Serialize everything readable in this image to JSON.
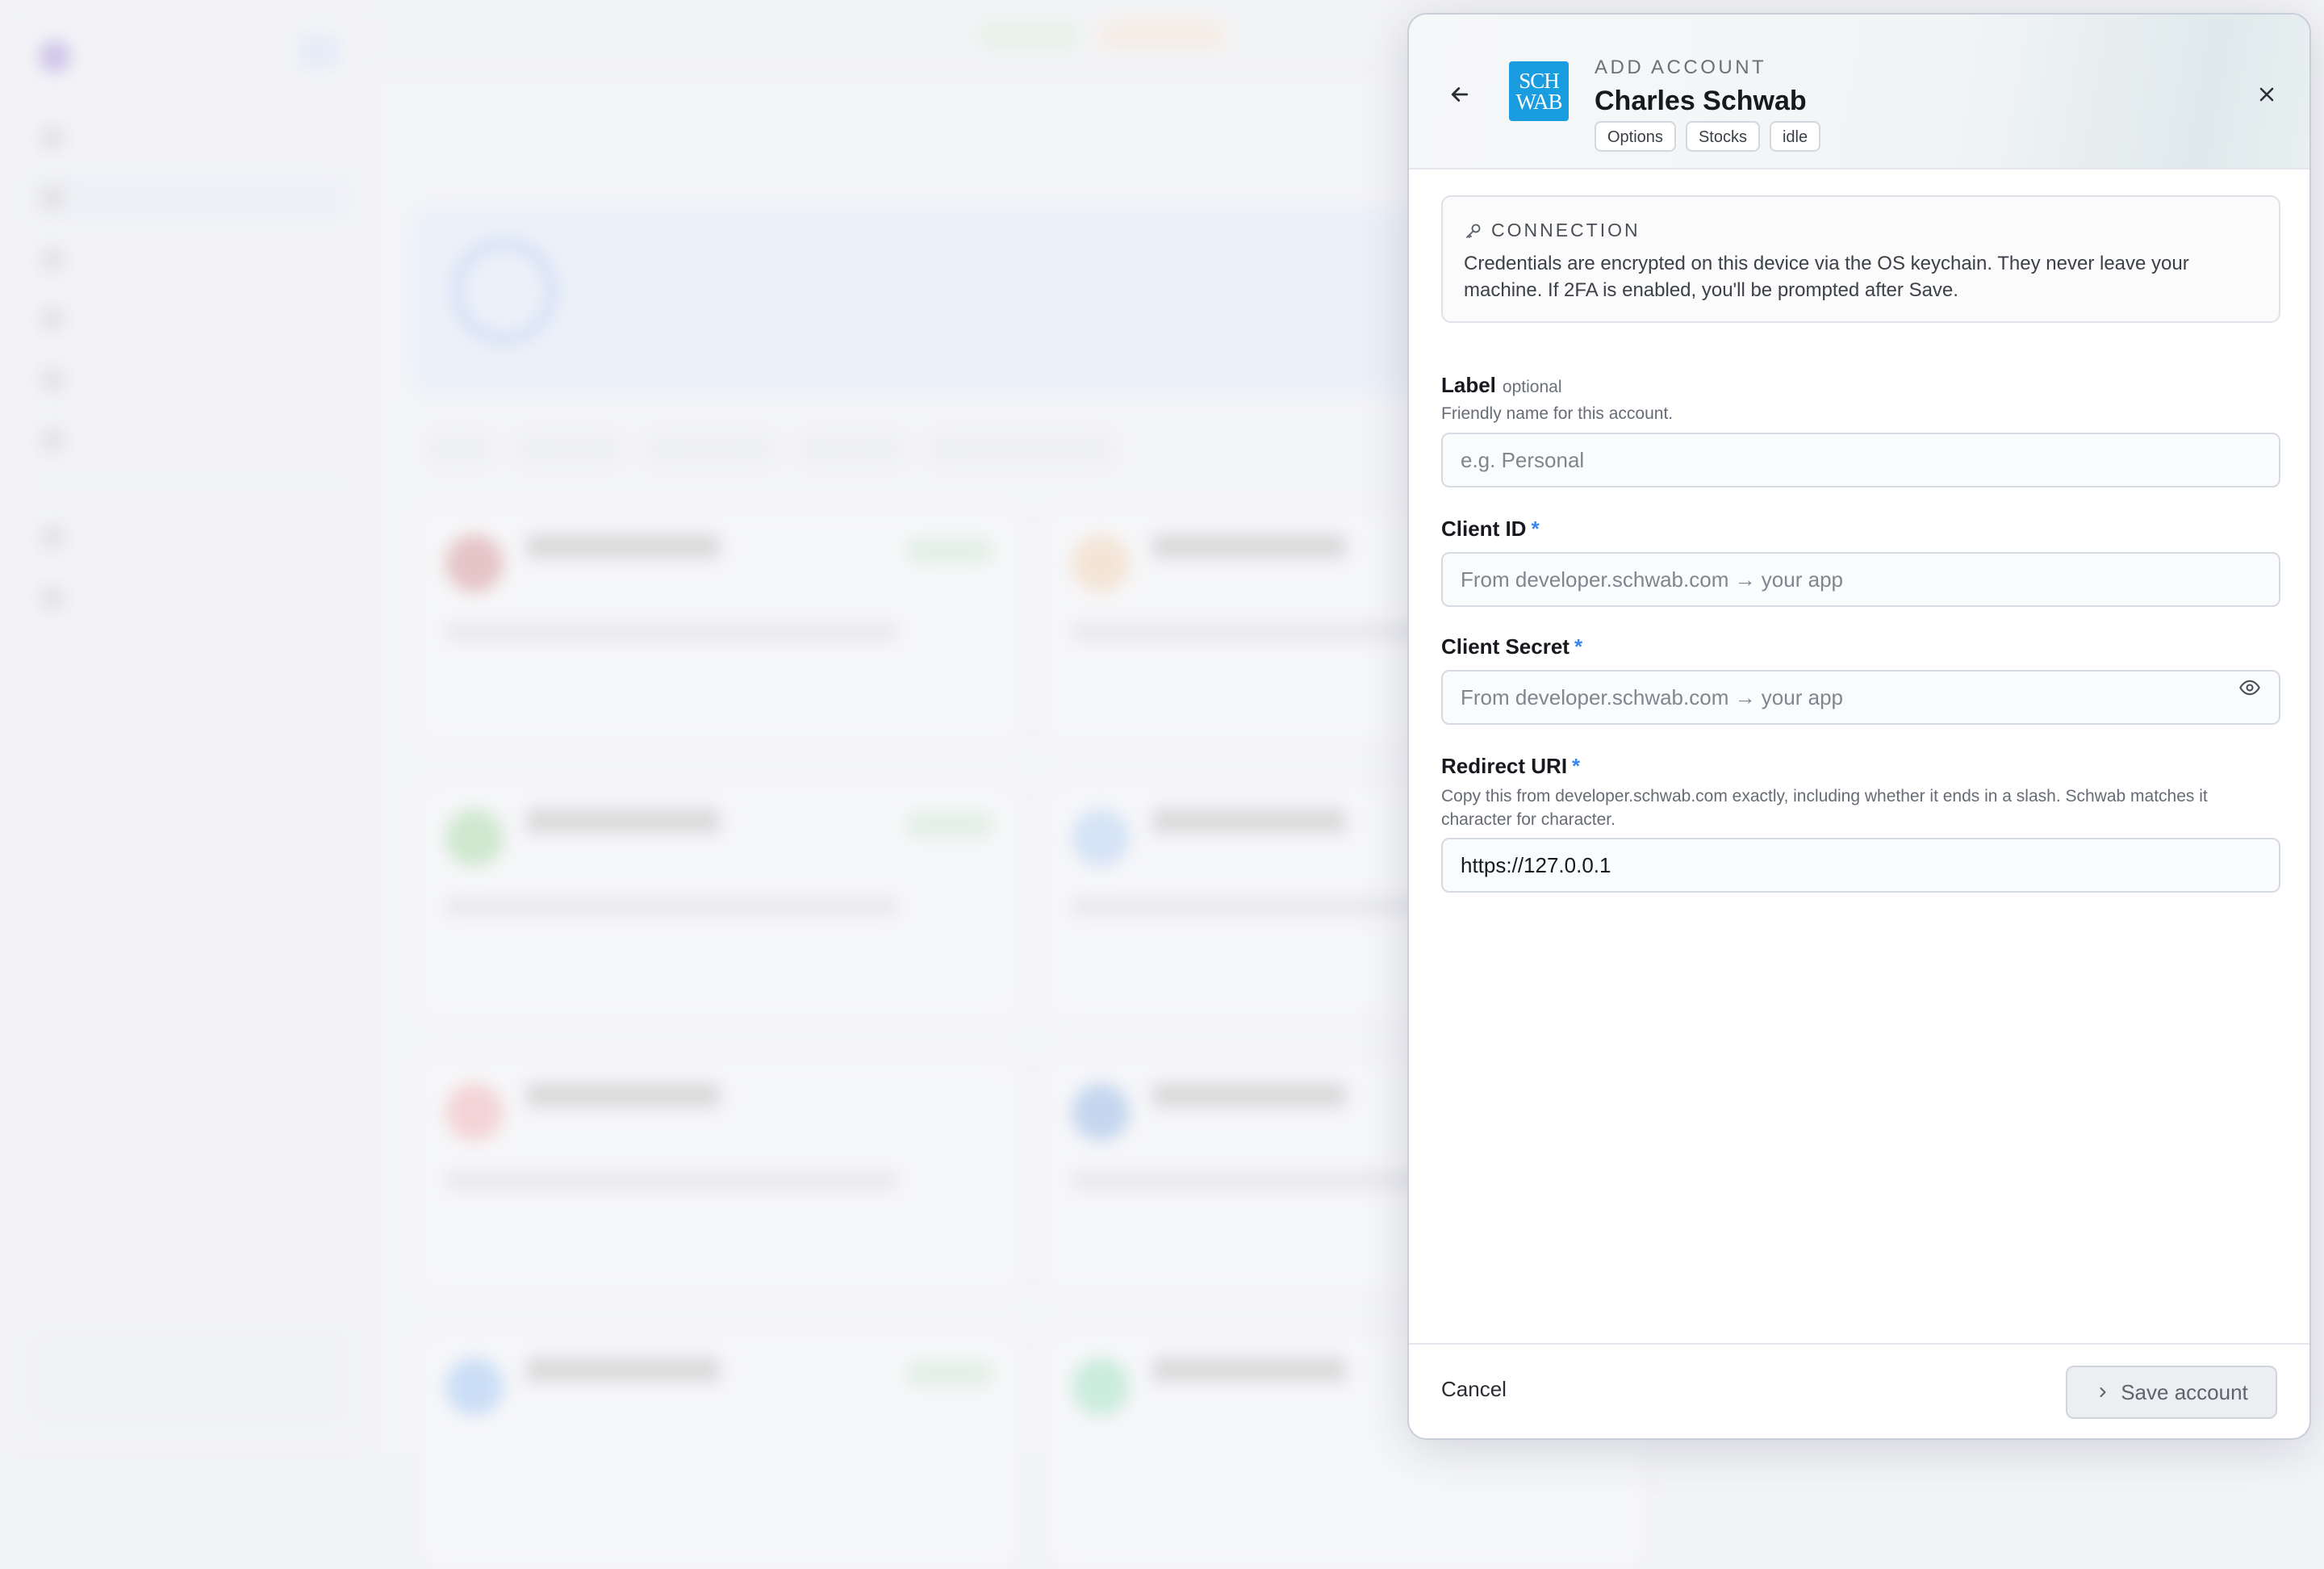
{
  "panel": {
    "eyebrow": "ADD ACCOUNT",
    "title": "Charles Schwab",
    "logo_lines": [
      "SCH",
      "WAB"
    ],
    "tags": [
      "Options",
      "Stocks",
      "idle"
    ],
    "connection": {
      "heading": "CONNECTION",
      "text": "Credentials are encrypted on this device via the OS keychain. They never leave your machine. If 2FA is enabled, you'll be prompted after Save."
    },
    "fields": {
      "label": {
        "label": "Label",
        "optional": "optional",
        "help": "Friendly name for this account.",
        "placeholder": "e.g. Personal",
        "value": ""
      },
      "client_id": {
        "label": "Client ID",
        "required": "*",
        "placeholder": "From developer.schwab.com → your app",
        "value": ""
      },
      "client_secret": {
        "label": "Client Secret",
        "required": "*",
        "placeholder": "From developer.schwab.com → your app",
        "value": ""
      },
      "redirect_uri": {
        "label": "Redirect URI",
        "required": "*",
        "help": "Copy this from developer.schwab.com exactly, including whether it ends in a slash. Schwab matches it character for character.",
        "value": "https://127.0.0.1"
      }
    },
    "footer": {
      "cancel": "Cancel",
      "save": "Save account"
    }
  },
  "colors": {
    "accent": "#3a86f0",
    "schwab_blue": "#1a9ce0"
  },
  "icons": [
    "arrow-left-icon",
    "close-icon",
    "key-icon",
    "eye-icon",
    "chevron-right-icon"
  ]
}
